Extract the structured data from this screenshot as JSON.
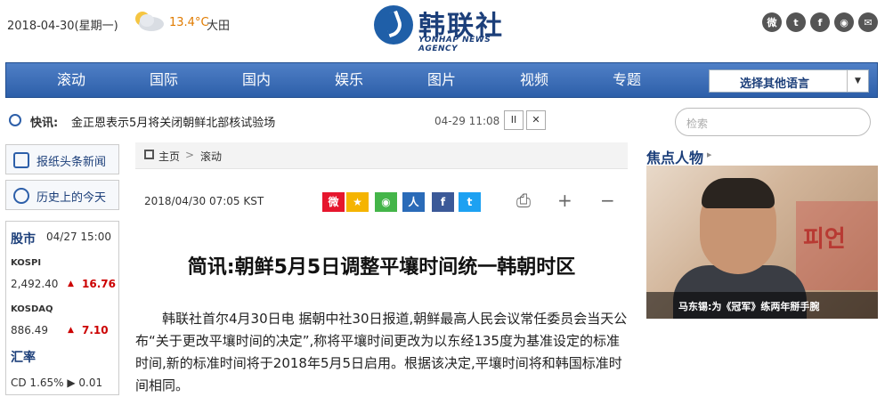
{
  "header": {
    "date": "2018-04-30(星期一)",
    "temperature": "13.4°C",
    "city": "大田",
    "logo_cn": "韩联社",
    "logo_en": "YONHAP NEWS AGENCY",
    "social_icons": [
      "weibo-icon",
      "twitter-icon",
      "facebook-icon",
      "wechat-icon",
      "email-icon"
    ]
  },
  "nav": {
    "items": [
      "滚动",
      "国际",
      "国内",
      "娱乐",
      "图片",
      "视频",
      "专题"
    ],
    "language_select": "选择其他语言"
  },
  "flash": {
    "label": "快讯:",
    "text": "金正恩表示5月将关闭朝鲜北部核试验场",
    "time": "04-29 11:08",
    "pause": "II"
  },
  "search": {
    "placeholder": "检索"
  },
  "sidebar": {
    "headlines": "报纸头条新闻",
    "history": "历史上的今天",
    "stock": {
      "title": "股市",
      "date": "04/27 15:00",
      "kospi": {
        "name": "KOSPI",
        "value": "2,492.40",
        "change": "16.76"
      },
      "kosdaq": {
        "name": "KOSDAQ",
        "value": "886.49",
        "change": "7.10"
      }
    },
    "fx": {
      "title": "汇率",
      "cd": "CD 1.65% ▶ 0.01"
    }
  },
  "breadcrumb": {
    "home": "主页",
    "sep": ">",
    "current": "滚动"
  },
  "article": {
    "datetime": "2018/04/30 07:05 KST",
    "title": "简讯:朝鲜5月5日调整平壤时间统一韩朝时区",
    "body": "韩联社首尔4月30日电 据朝中社30日报道,朝鲜最高人民会议常任委员会当天公布“关于更改平壤时间的决定”,称将平壤时间更改为以东经135度为基准设定的标准时间,新的标准时间将于2018年5月5日启用。根据该决定,平壤时间将和韩国标准时间相同。"
  },
  "focus": {
    "title": "焦点人物",
    "caption": "马东锡:为《冠军》练两年掰手腕",
    "photo_text": "피언"
  },
  "colors": {
    "nav": "#2d5fa9",
    "accent": "#1c3f7a",
    "up": "#cc0000"
  }
}
